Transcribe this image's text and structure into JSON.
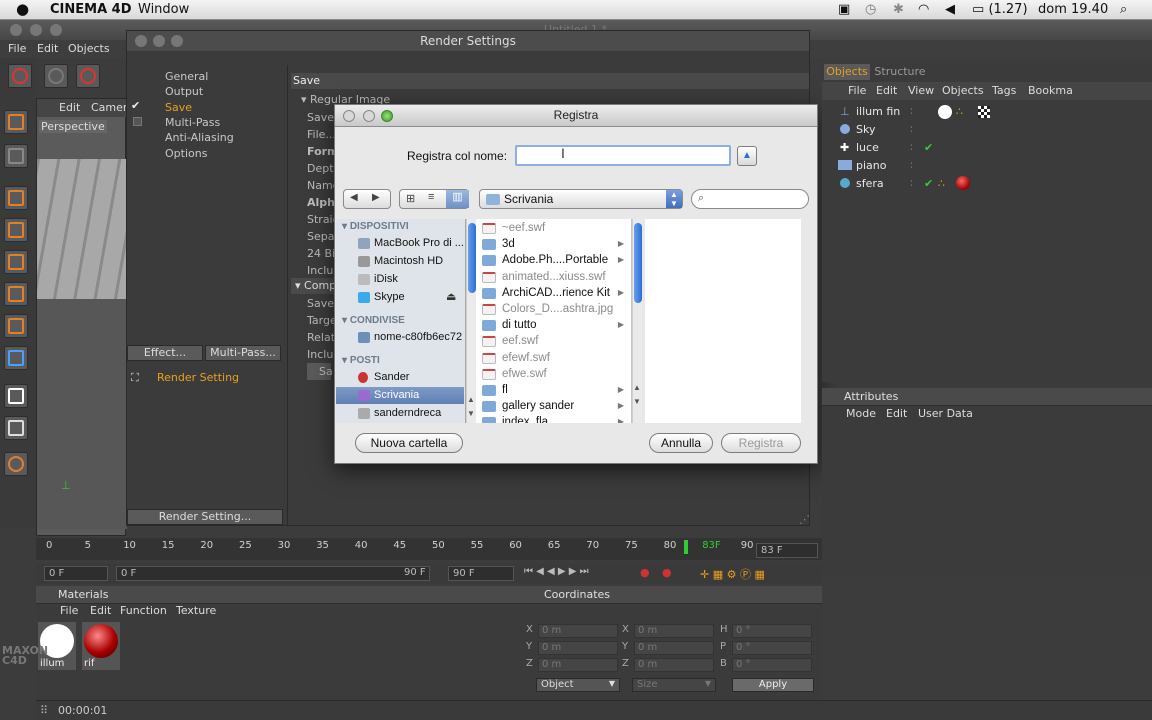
{
  "menubar": {
    "apple": "",
    "app": "CINEMA 4D",
    "menu_window": "Window",
    "battery": "(1.27)",
    "clock": "dom 19.40"
  },
  "c4d_menu": [
    "File",
    "Edit",
    "Objects"
  ],
  "doc_title": "Untitled 1 *",
  "viewport": {
    "menu_edit": "Edit",
    "menu_camera": "Camera",
    "label": "Perspective"
  },
  "render_settings": {
    "title": "Render Settings",
    "nav": [
      "General",
      "Output",
      "Save",
      "Multi-Pass",
      "Anti-Aliasing",
      "Options"
    ],
    "effect_btn": "Effect...",
    "multipass_btn": "Multi-Pass...",
    "setting_item": "Render Setting",
    "render_setting_btn": "Render Setting...",
    "save_header": "Save",
    "regular_image": "Regular Image",
    "rows": [
      "Save",
      "File...",
      "Form",
      "Depth",
      "Name",
      "Alph",
      "Straig",
      "Separ",
      "24 Bi",
      "Inclu"
    ],
    "comp_header": "Comp",
    "rows2": [
      "Save",
      "Targe",
      "Relati",
      "Inclu",
      "Sa"
    ]
  },
  "save_dialog": {
    "title": "Registra",
    "name_label": "Registra col nome:",
    "name_value": "",
    "location": "Scrivania",
    "search_placeholder": "",
    "sections": {
      "devices": "DISPOSITIVI",
      "shared": "CONDIVISE",
      "places": "POSTI"
    },
    "devices": [
      "MacBook Pro di ...",
      "Macintosh HD",
      "iDisk",
      "Skype"
    ],
    "shared": [
      "nome-c80fb6ec72"
    ],
    "places": [
      "Sander",
      "Scrivania",
      "sanderndreca"
    ],
    "files": [
      {
        "name": "~eef.swf",
        "dim": true,
        "folder": false,
        "arrow": false
      },
      {
        "name": "3d",
        "dim": false,
        "folder": true,
        "arrow": true
      },
      {
        "name": "Adobe.Ph....Portable",
        "dim": false,
        "folder": true,
        "arrow": true
      },
      {
        "name": "animated...xiuss.swf",
        "dim": true,
        "folder": false,
        "arrow": false
      },
      {
        "name": "ArchiCAD...rience Kit",
        "dim": false,
        "folder": true,
        "arrow": true
      },
      {
        "name": "Colors_D....ashtra.jpg",
        "dim": true,
        "folder": false,
        "arrow": false
      },
      {
        "name": "di tutto",
        "dim": false,
        "folder": true,
        "arrow": true
      },
      {
        "name": "eef.swf",
        "dim": true,
        "folder": false,
        "arrow": false
      },
      {
        "name": "efewf.swf",
        "dim": true,
        "folder": false,
        "arrow": false
      },
      {
        "name": "efwe.swf",
        "dim": true,
        "folder": false,
        "arrow": false
      },
      {
        "name": "fl",
        "dim": false,
        "folder": true,
        "arrow": true
      },
      {
        "name": "gallery sander",
        "dim": false,
        "folder": true,
        "arrow": true
      },
      {
        "name": "index_fla",
        "dim": false,
        "folder": true,
        "arrow": true
      }
    ],
    "new_folder_btn": "Nuova cartella",
    "cancel_btn": "Annulla",
    "save_btn": "Registra"
  },
  "object_manager": {
    "tabs": [
      "Objects",
      "Structure"
    ],
    "menu": [
      "File",
      "Edit",
      "View",
      "Objects",
      "Tags",
      "Bookma"
    ],
    "objects": [
      "illum fin",
      "Sky",
      "luce",
      "piano",
      "sfera"
    ]
  },
  "attributes": {
    "title": "Attributes",
    "menu": [
      "Mode",
      "Edit",
      "User Data"
    ]
  },
  "timeline": {
    "ticks": [
      "0",
      "5",
      "10",
      "15",
      "20",
      "25",
      "30",
      "35",
      "40",
      "45",
      "50",
      "55",
      "60",
      "65",
      "70",
      "75",
      "80",
      "83F",
      "90"
    ],
    "current_frame": "83 F",
    "start": "0 F",
    "range_start": "0 F",
    "range_end": "90 F",
    "end": "90 F"
  },
  "materials": {
    "title": "Materials",
    "menu": [
      "File",
      "Edit",
      "Function",
      "Texture"
    ],
    "items": [
      "illum",
      "rif"
    ]
  },
  "coordinates": {
    "title": "Coordinates",
    "pos": [
      [
        "X",
        "0 m"
      ],
      [
        "Y",
        "0 m"
      ],
      [
        "Z",
        "0 m"
      ]
    ],
    "scale": [
      [
        "X",
        "0 m"
      ],
      [
        "Y",
        "0 m"
      ],
      [
        "Z",
        "0 m"
      ]
    ],
    "rot": [
      [
        "H",
        "0 °"
      ],
      [
        "P",
        "0 °"
      ],
      [
        "B",
        "0 °"
      ]
    ],
    "mode": "Object",
    "size_mode": "Size",
    "apply": "Apply"
  },
  "status": {
    "time": "00:00:01"
  },
  "colors": {
    "c4d_orange": "#e8a020",
    "mac_blue": "#5f7fb1"
  }
}
